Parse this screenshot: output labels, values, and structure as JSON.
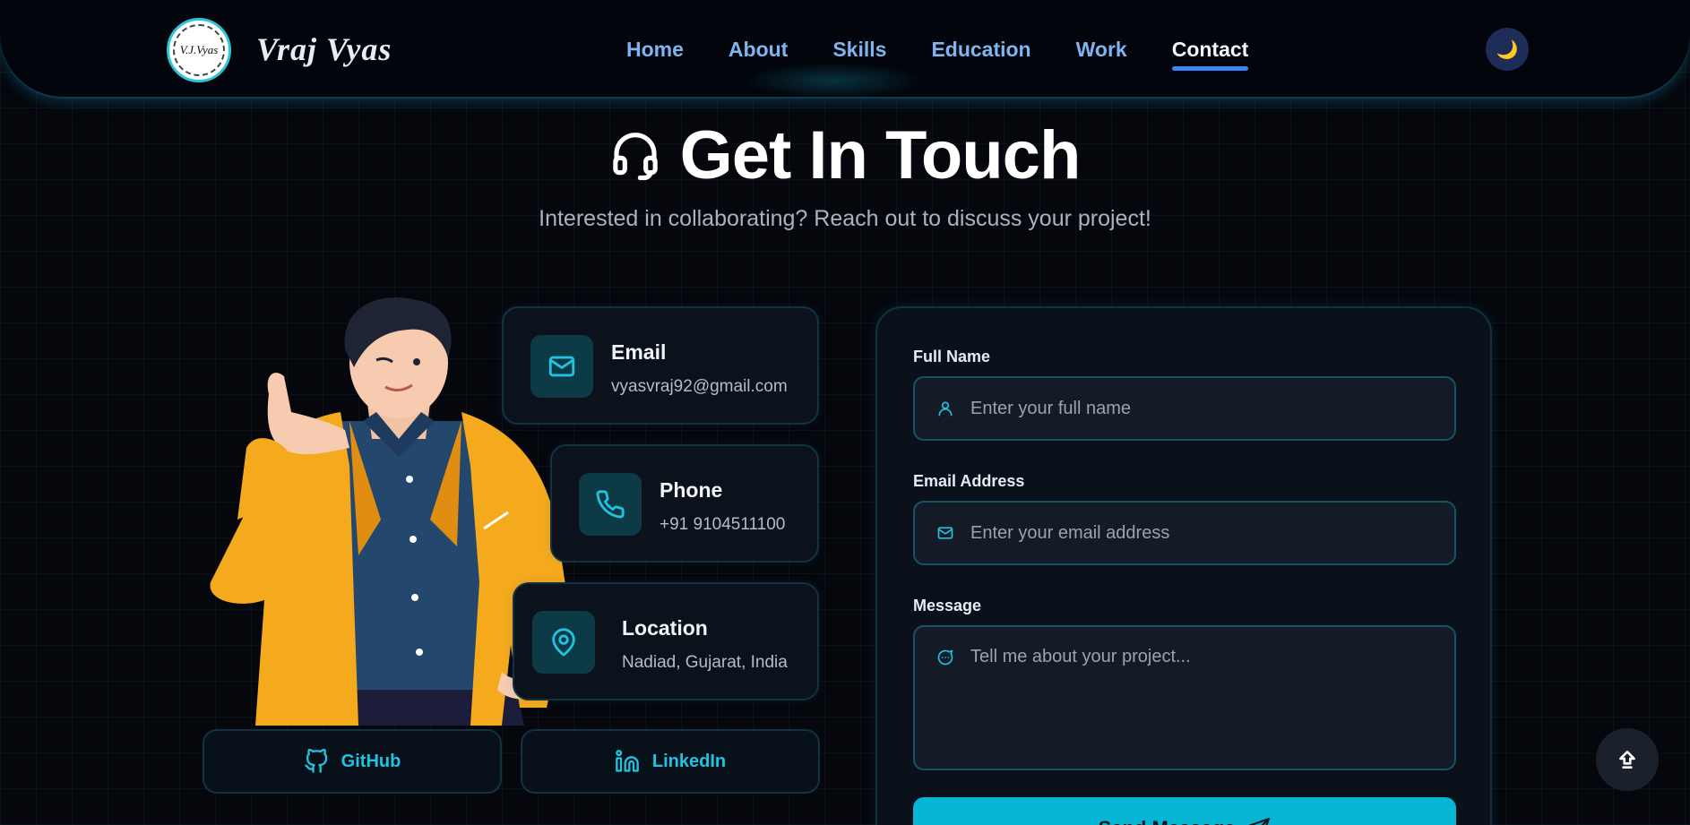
{
  "navbar": {
    "logo_text": "V.J.Vyas",
    "brand": "Vraj Vyas",
    "links": [
      {
        "label": "Home",
        "active": false
      },
      {
        "label": "About",
        "active": false
      },
      {
        "label": "Skills",
        "active": false
      },
      {
        "label": "Education",
        "active": false
      },
      {
        "label": "Work",
        "active": false
      },
      {
        "label": "Contact",
        "active": true
      }
    ],
    "theme_icon": "moon-icon"
  },
  "header": {
    "title": "Get In Touch",
    "icon": "headset-icon",
    "subtitle": "Interested in collaborating? Reach out to discuss your project!"
  },
  "contact_info": {
    "email": {
      "label": "Email",
      "value": "vyasvraj92@gmail.com",
      "icon": "mail-icon"
    },
    "phone": {
      "label": "Phone",
      "value": "+91 9104511100",
      "icon": "phone-icon"
    },
    "location": {
      "label": "Location",
      "value": "Nadiad, Gujarat, India",
      "icon": "map-pin-icon"
    }
  },
  "social": {
    "github": {
      "label": "GitHub",
      "icon": "github-icon"
    },
    "linkedin": {
      "label": "LinkedIn",
      "icon": "linkedin-icon"
    }
  },
  "form": {
    "full_name": {
      "label": "Full Name",
      "placeholder": "Enter your full name",
      "value": ""
    },
    "email": {
      "label": "Email Address",
      "placeholder": "Enter your email address",
      "value": ""
    },
    "message": {
      "label": "Message",
      "placeholder": "Tell me about your project...",
      "value": ""
    },
    "submit_label": "Send Message"
  },
  "colors": {
    "background": "#05070d",
    "accent": "#06b6d4",
    "nav_link": "#7fb4f0",
    "active_underline": "#3b82f6",
    "card_border": "#13323f"
  }
}
